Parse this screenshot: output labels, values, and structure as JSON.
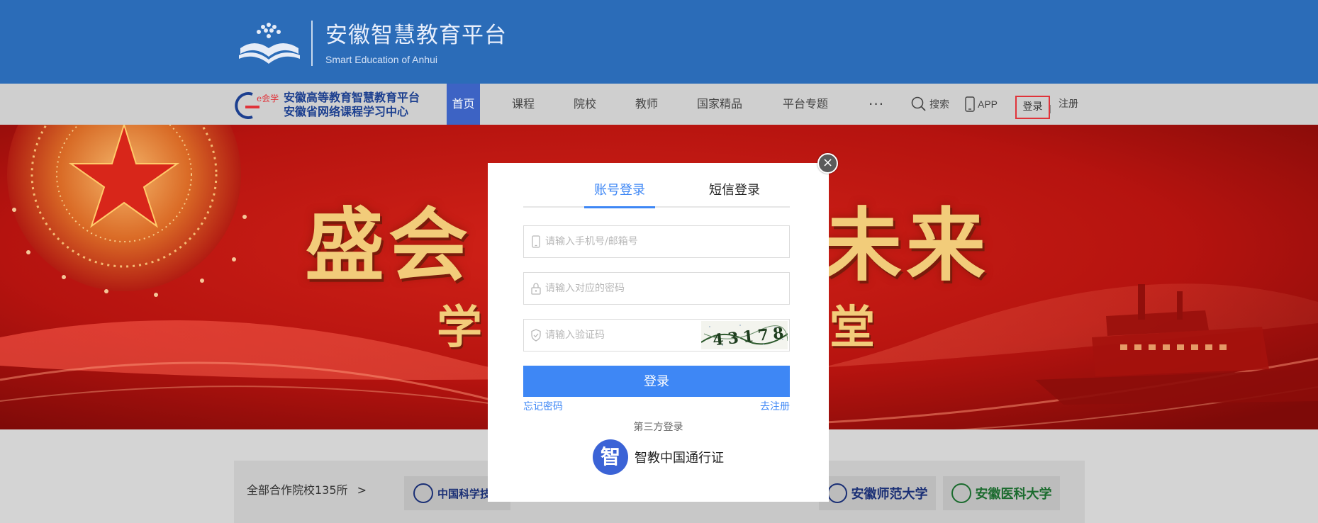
{
  "header": {
    "title": "安徽智慧教育平台",
    "subtitle": "Smart Education of Anhui"
  },
  "nav": {
    "logo_line1": "安徽高等教育智慧教育平台",
    "logo_line2": "安徽省网络课程学习中心",
    "logo_badge": "e会学",
    "items": [
      {
        "label": "首页",
        "active": true
      },
      {
        "label": "课程"
      },
      {
        "label": "院校"
      },
      {
        "label": "教师"
      },
      {
        "label": "国家精品"
      },
      {
        "label": "平台专题"
      }
    ],
    "more": "···",
    "search": "搜索",
    "app": "APP",
    "login": "登录",
    "register": "注册"
  },
  "banner": {
    "line1_left": "盛会",
    "line1_right": "未来",
    "line2_left": "学",
    "line2_right": "堂"
  },
  "partners": {
    "label": "全部合作院校135所",
    "arrow": ">",
    "items": [
      {
        "name": "中国科学技术"
      },
      {
        "name": "安徽师范大学"
      },
      {
        "name": "安徽医科大学"
      }
    ]
  },
  "login_modal": {
    "close": "×",
    "tabs": [
      {
        "label": "账号登录",
        "active": true
      },
      {
        "label": "短信登录"
      }
    ],
    "account_placeholder": "请输入手机号/邮箱号",
    "password_placeholder": "请输入对应的密码",
    "captcha_placeholder": "请输入验证码",
    "captcha_text": "43178",
    "submit": "登录",
    "forgot": "忘记密码",
    "register": "去注册",
    "third_party_label": "第三方登录",
    "third_party_icon_char": "智",
    "third_party_name": "智教中国通行证"
  },
  "colors": {
    "header_blue": "#2b6cb8",
    "nav_active": "#3d63c4",
    "primary_blue": "#3e87f5",
    "banner_red": "#c41a16",
    "highlight_red": "#e0333a"
  }
}
